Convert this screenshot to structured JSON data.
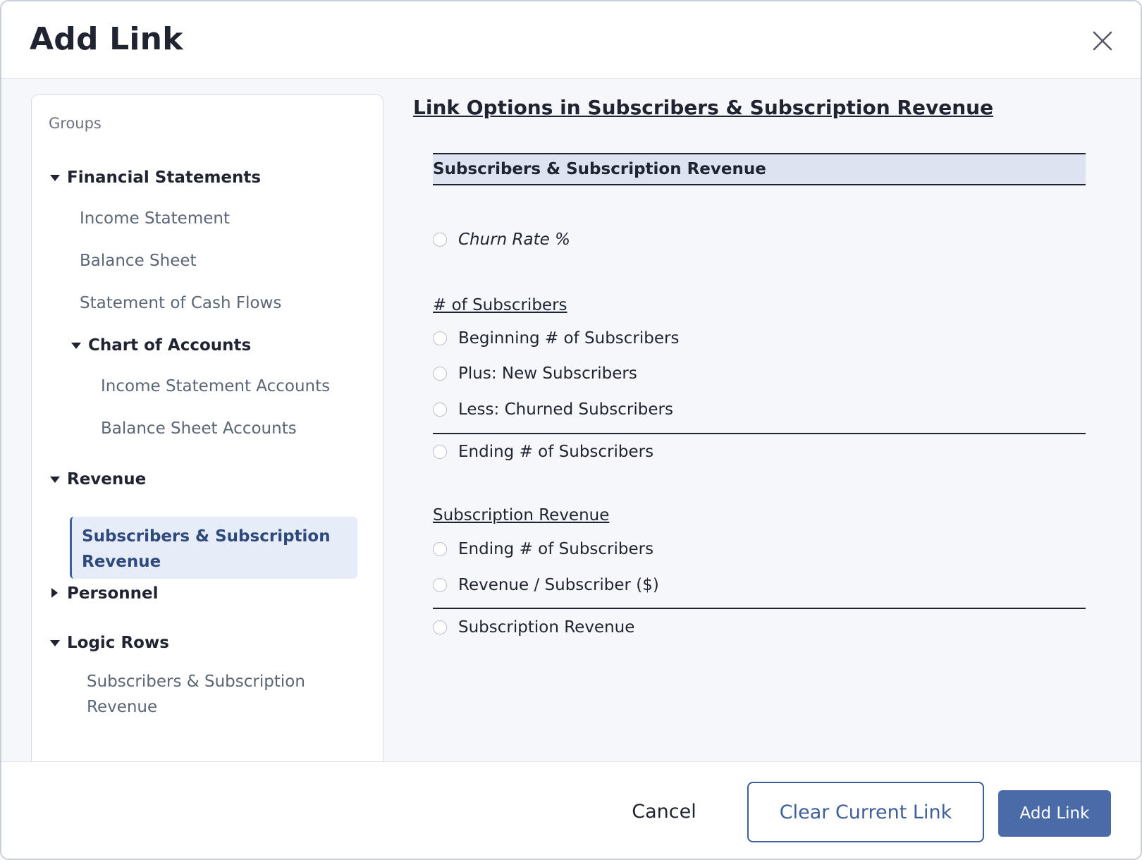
{
  "dialog": {
    "title": "Add Link",
    "close_icon": "close-icon"
  },
  "groups": {
    "label": "Groups",
    "tree": {
      "financial_statements": "Financial Statements",
      "income_statement": "Income Statement",
      "balance_sheet": "Balance Sheet",
      "cash_flows": "Statement of Cash Flows",
      "chart_of_accounts": "Chart of Accounts",
      "income_statement_accounts": "Income Statement Accounts",
      "balance_sheet_accounts": "Balance Sheet Accounts",
      "revenue": "Revenue",
      "subscribers_revenue": "Subscribers & Subscription Revenue",
      "personnel": "Personnel",
      "logic_rows": "Logic Rows",
      "logic_subscribers_revenue": "Subscribers & Subscription Revenue"
    },
    "selected": "Subscribers & Subscription Revenue"
  },
  "options": {
    "title": "Link Options in Subscribers & Subscription Revenue",
    "group_header": "Subscribers & Subscription Revenue",
    "churn_rate": "Churn Rate %",
    "section_subscribers": "# of Subscribers",
    "beginning": "Beginning # of Subscribers",
    "plus_new": "Plus: New Subscribers",
    "less_churned": "Less: Churned Subscribers",
    "ending": "Ending # of Subscribers",
    "section_revenue": "Subscription Revenue",
    "rev_ending": "Ending # of Subscribers",
    "rev_per_sub": "Revenue / Subscriber ($)",
    "rev_total": "Subscription Revenue"
  },
  "footer": {
    "cancel": "Cancel",
    "clear": "Clear Current Link",
    "add": "Add Link"
  },
  "colors": {
    "accent": "#4a6aa8",
    "selected_bg": "#e7edf8",
    "header_band": "#dde3f1"
  }
}
